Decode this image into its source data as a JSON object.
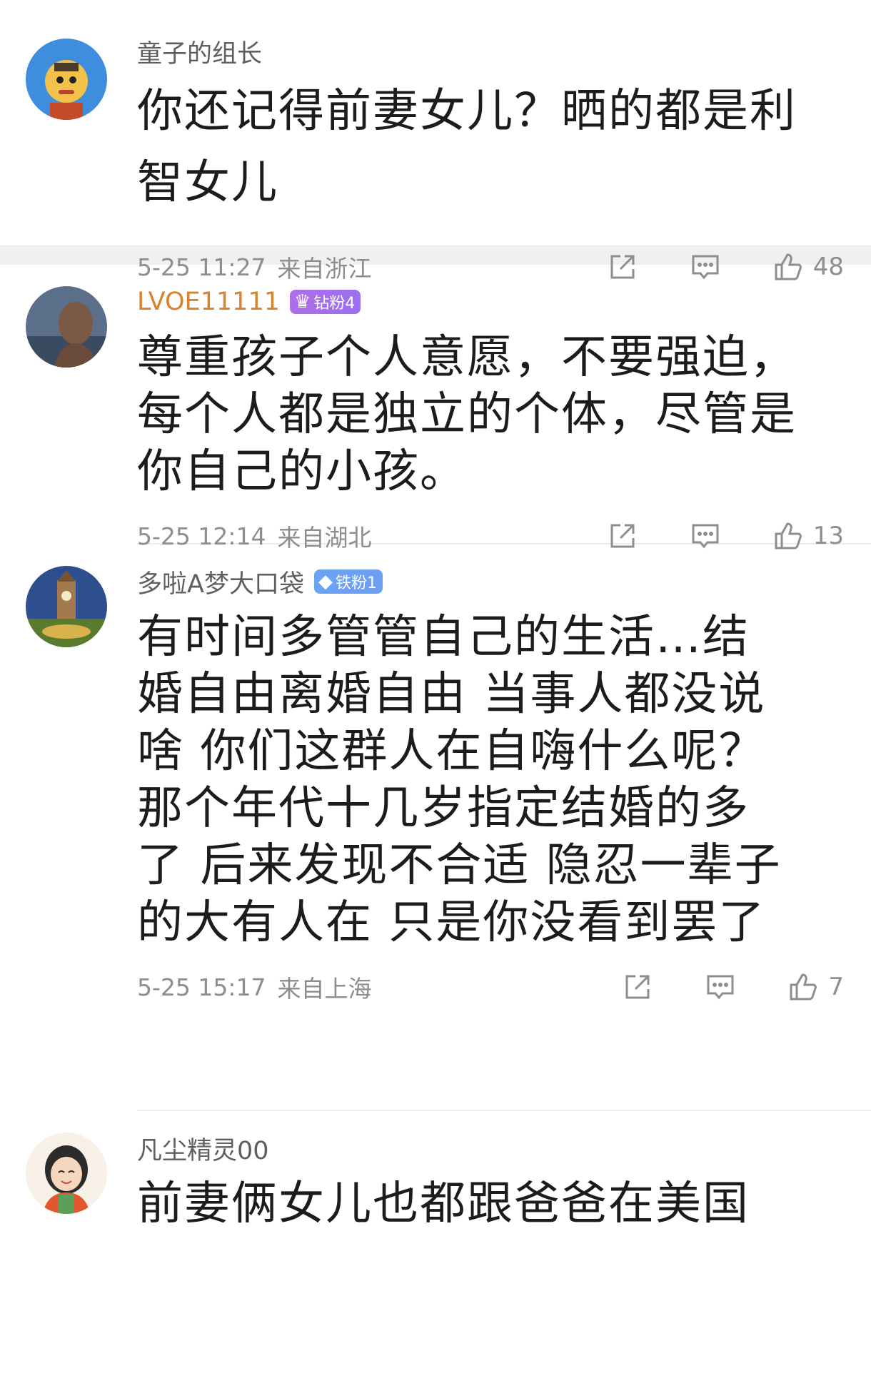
{
  "comments": [
    {
      "user": "童子的组长",
      "text_lines": [
        "你还记得前妻女儿？晒的都是利",
        "智女儿"
      ],
      "time": "5-25 11:27",
      "location": "来自浙江",
      "likes": "48"
    },
    {
      "user": "LVOE11111",
      "badge": {
        "label": "钻粉4",
        "icon": "crown-icon"
      },
      "text_lines": [
        "尊重孩子个人意愿，不要强迫，",
        "每个人都是独立的个体，尽管是",
        "你自己的小孩。"
      ],
      "time": "5-25 12:14",
      "location": "来自湖北",
      "likes": "13"
    },
    {
      "user": "多啦A梦大口袋",
      "badge": {
        "label": "铁粉1",
        "icon": "diamond-icon"
      },
      "text_lines": [
        "有时间多管管自己的生活…结",
        "婚自由离婚自由 当事人都没说",
        "啥 你们这群人在自嗨什么呢？",
        "那个年代十几岁指定结婚的多",
        "了 后来发现不合适 隐忍一辈子",
        "的大有人在 只是你没看到罢了"
      ],
      "time": "5-25 15:17",
      "location": "来自上海",
      "likes": "7"
    },
    {
      "user": "凡尘精灵00",
      "text_lines": [
        "前妻俩女儿也都跟爸爸在美国"
      ]
    }
  ],
  "colors": {
    "username": "#5f5f5f",
    "vip_username": "#d9822b",
    "text": "#1c1c1c",
    "meta": "#8e8e8e",
    "divider": "#f0f0f0"
  }
}
